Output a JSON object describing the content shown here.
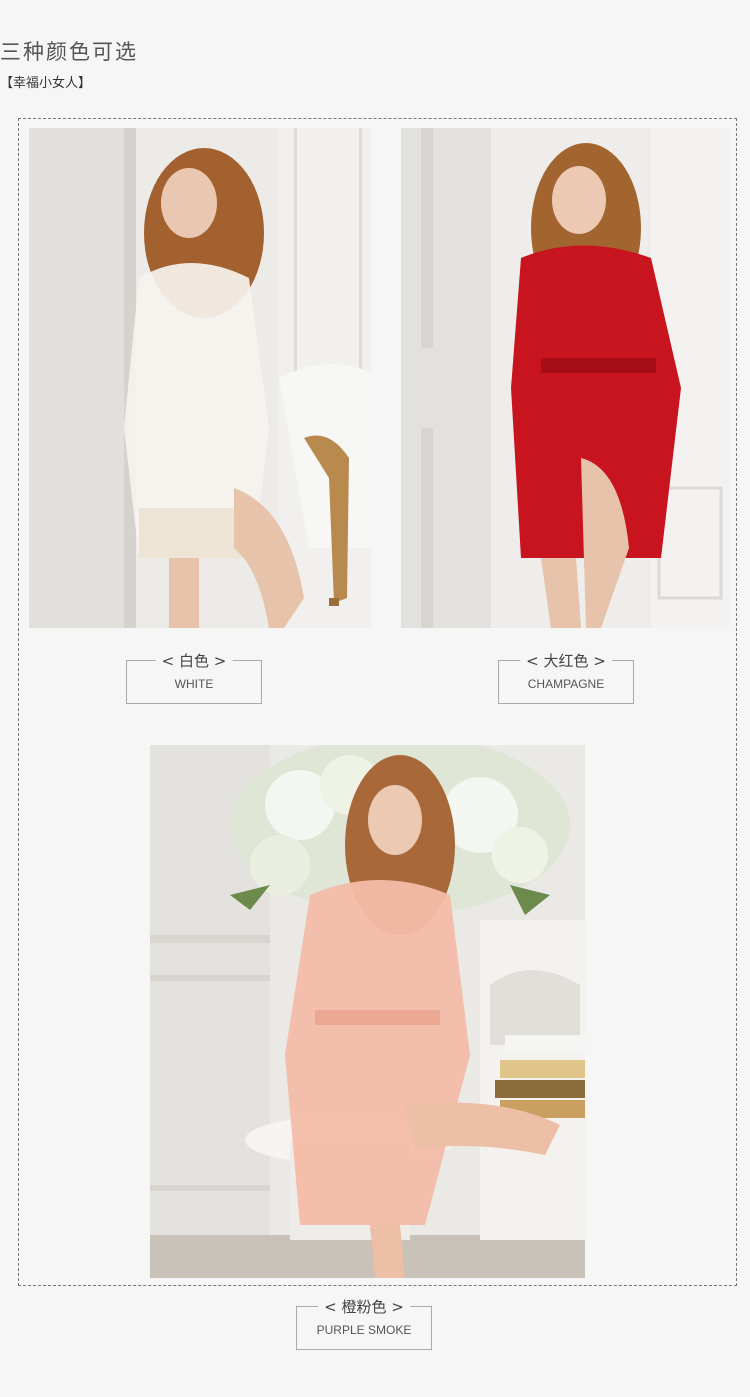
{
  "header": {
    "title": "三种颜色可选",
    "subtitle": "【幸福小女人】"
  },
  "variants": [
    {
      "cn": "< 白色 >",
      "en": "WHITE",
      "robe_color": "#f4f0ea"
    },
    {
      "cn": "< 大红色 >",
      "en": "CHAMPAGNE",
      "robe_color": "#c8141f"
    },
    {
      "cn": "< 橙粉色 >",
      "en": "PURPLE SMOKE",
      "robe_color": "#f3b9a8"
    }
  ]
}
